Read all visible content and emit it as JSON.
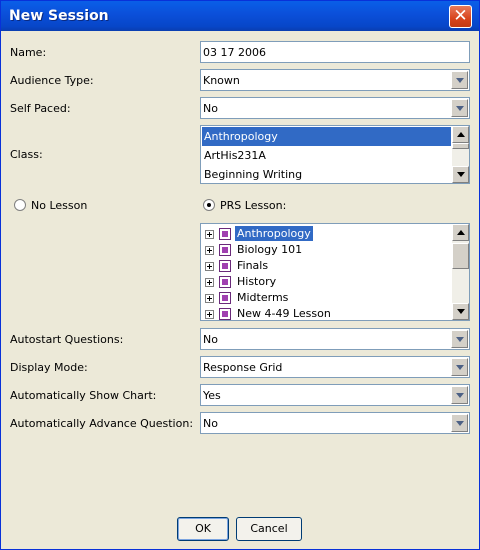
{
  "window": {
    "title": "New Session",
    "close_glyph": "✕"
  },
  "form": {
    "name": {
      "label": "Name:",
      "value": "03 17 2006"
    },
    "audience_type": {
      "label": "Audience Type:",
      "value": "Known"
    },
    "self_paced": {
      "label": "Self Paced:",
      "value": "No"
    },
    "class": {
      "label": "Class:",
      "items": [
        "Anthropology",
        "ArtHis231A",
        "Beginning Writing"
      ],
      "selected": "Anthropology"
    },
    "lesson_mode": {
      "no_lesson_label": "No Lesson",
      "prs_lesson_label": "PRS Lesson:",
      "selected": "PRS Lesson:"
    },
    "lessons": {
      "items": [
        "Anthropology",
        "Biology 101",
        "Finals",
        "History",
        "Midterms",
        "New 4-49 Lesson"
      ],
      "selected": "Anthropology"
    },
    "autostart_questions": {
      "label": "Autostart Questions:",
      "value": "No"
    },
    "display_mode": {
      "label": "Display Mode:",
      "value": "Response Grid"
    },
    "auto_show_chart": {
      "label": "Automatically Show Chart:",
      "value": "Yes"
    },
    "auto_advance_question": {
      "label": "Automatically Advance Question:",
      "value": "No"
    }
  },
  "buttons": {
    "ok": "OK",
    "cancel": "Cancel"
  },
  "colors": {
    "titlebar": "#0b4fd9",
    "selection": "#316ac5",
    "close": "#d8441c",
    "dialog_bg": "#ece9d8"
  }
}
